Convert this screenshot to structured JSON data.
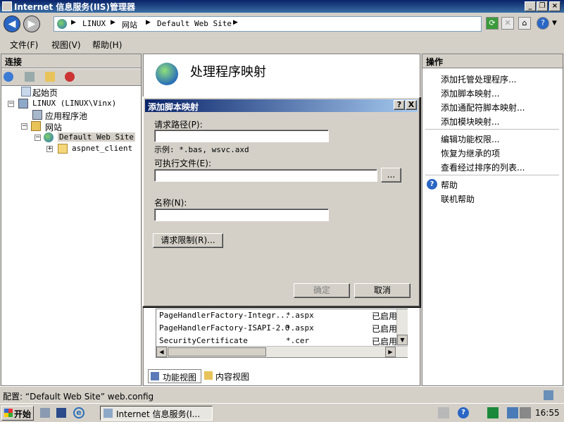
{
  "window": {
    "title": "Internet 信息服务(IIS)管理器"
  },
  "address": {
    "crumbs": [
      "LINUX",
      "网站",
      "Default Web Site"
    ]
  },
  "menu": {
    "items": [
      "文件(F)",
      "视图(V)",
      "帮助(H)"
    ]
  },
  "connections": {
    "header": "连接",
    "tree": [
      "起始页",
      "LINUX (LINUX\\Vinx)",
      "应用程序池",
      "网站",
      "Default Web Site",
      "aspnet_client"
    ]
  },
  "center": {
    "title": "处理程序映射",
    "rows": [
      {
        "name": "PageHandlerFactory-Integr...",
        "path": "*.aspx",
        "state": "已启用"
      },
      {
        "name": "PageHandlerFactory-ISAPI-2.0",
        "path": "*.aspx",
        "state": "已启用"
      },
      {
        "name": "SecurityCertificate",
        "path": "*.cer",
        "state": "已启用"
      }
    ],
    "tabs": {
      "features": "功能视图",
      "content": "内容视图"
    }
  },
  "actions": {
    "header": "操作",
    "group1": [
      "添加托管处理程序...",
      "添加脚本映射...",
      "添加通配符脚本映射...",
      "添加模块映射..."
    ],
    "group2": [
      "编辑功能权限...",
      "恢复为继承的项",
      "查看经过排序的列表..."
    ],
    "help": [
      "帮助",
      "联机帮助"
    ]
  },
  "dialog": {
    "title": "添加脚本映射",
    "help_btn": "?",
    "close_btn": "X",
    "request_path_label": "请求路径(P):",
    "request_path_value": "",
    "example": "示例: *.bas, wsvc.axd",
    "executable_label": "可执行文件(E):",
    "executable_value": "",
    "browse": "...",
    "name_label": "名称(N):",
    "name_value": "",
    "restrictions": "请求限制(R)...",
    "ok": "确定",
    "cancel": "取消"
  },
  "status": {
    "text": "配置: “Default Web Site” web.config"
  },
  "taskbar": {
    "start": "开始",
    "task": "Internet 信息服务(I...",
    "clock": "16:55"
  },
  "colors": {
    "titlebar": "#0a246a",
    "link": "#000000",
    "panel_bg": "#ffffff",
    "chrome": "#d4d0c8"
  }
}
